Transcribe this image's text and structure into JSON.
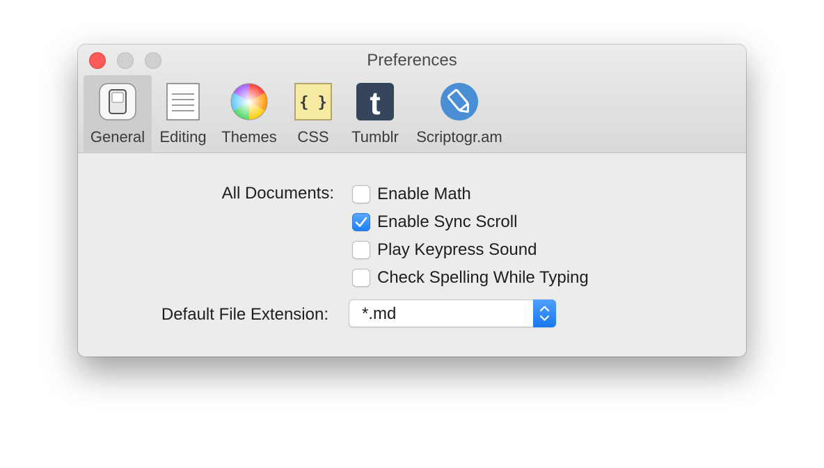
{
  "window": {
    "title": "Preferences"
  },
  "toolbar": {
    "tabs": [
      {
        "label": "General",
        "icon": "general-switch-icon",
        "selected": true
      },
      {
        "label": "Editing",
        "icon": "document-lines-icon"
      },
      {
        "label": "Themes",
        "icon": "color-wheel-icon"
      },
      {
        "label": "CSS",
        "icon": "braces-icon"
      },
      {
        "label": "Tumblr",
        "icon": "tumblr-icon"
      },
      {
        "label": "Scriptogr.am",
        "icon": "scriptogram-icon"
      }
    ]
  },
  "general": {
    "all_documents_label": "All Documents:",
    "options": [
      {
        "label": "Enable Math",
        "checked": false
      },
      {
        "label": "Enable Sync Scroll",
        "checked": true
      },
      {
        "label": "Play Keypress Sound",
        "checked": false
      },
      {
        "label": "Check Spelling While Typing",
        "checked": false
      }
    ],
    "file_extension_label": "Default File Extension:",
    "file_extension_value": "*.md"
  },
  "colors": {
    "accent": "#1e7ef5",
    "close": "#fc5b57",
    "css_icon_bg": "#f6e9a1",
    "tumblr_bg": "#35465c",
    "scriptogram_bg": "#4a8fd6"
  }
}
